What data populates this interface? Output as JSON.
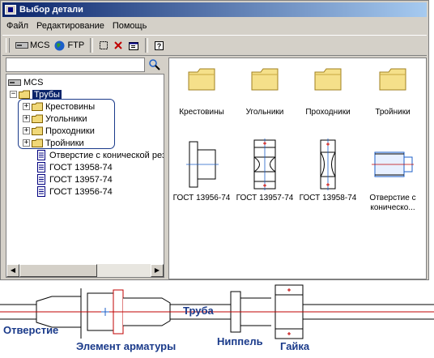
{
  "window": {
    "title": "Выбор детали"
  },
  "menu": [
    "Файл",
    "Редактирование",
    "Помощь"
  ],
  "toolbar": {
    "mcs_label": "MCS",
    "ftp_label": "FTP"
  },
  "search": {
    "value": ""
  },
  "tree": {
    "root": "MCS",
    "folder": "Трубы",
    "subfolders": [
      "Крестовины",
      "Угольники",
      "Проходники",
      "Тройники"
    ],
    "files": [
      "Отверстие с конической рез",
      "ГОСТ 13958-74",
      "ГОСТ 13957-74",
      "ГОСТ 13956-74"
    ]
  },
  "items": {
    "folders": [
      "Крестовины",
      "Угольники",
      "Проходники",
      "Тройники"
    ],
    "parts": [
      "ГОСТ 13956-74",
      "ГОСТ 13957-74",
      "ГОСТ 13958-74",
      "Отверстие с",
      "коническо..."
    ]
  },
  "diagram": {
    "labels": [
      "Отверстие",
      "Элемент арматуры",
      "Труба",
      "Ниппель",
      "Гайка"
    ]
  }
}
